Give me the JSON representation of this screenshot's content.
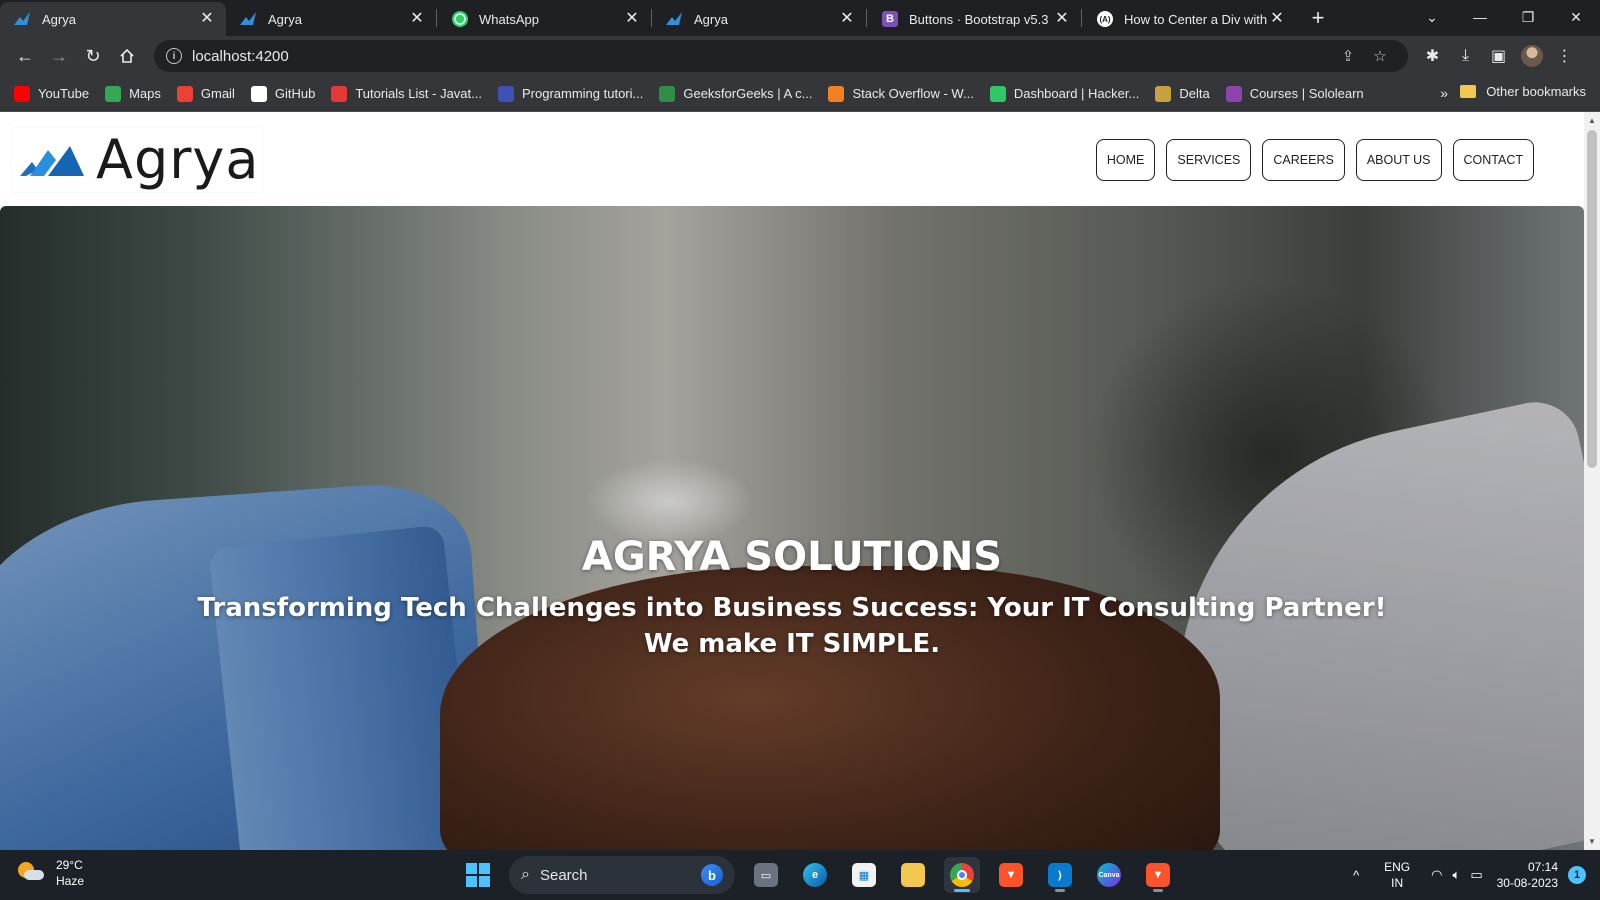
{
  "browser": {
    "tabs": [
      {
        "label": "Agrya",
        "icon": "agrya-favicon",
        "active": true
      },
      {
        "label": "Agrya",
        "icon": "agrya-favicon",
        "active": false
      },
      {
        "label": "WhatsApp",
        "icon": "whatsapp-favicon",
        "active": false
      },
      {
        "label": "Agrya",
        "icon": "agrya-favicon",
        "active": false
      },
      {
        "label": "Buttons · Bootstrap v5.3",
        "icon": "bootstrap-favicon",
        "active": false
      },
      {
        "label": "How to Center a Div with C",
        "icon": "css-favicon",
        "active": false
      }
    ],
    "address": "localhost:4200",
    "bookmarks": [
      {
        "label": "YouTube",
        "icon": "youtube-icon",
        "color": "#ff0000"
      },
      {
        "label": "Maps",
        "icon": "maps-icon",
        "color": "#34a853"
      },
      {
        "label": "Gmail",
        "icon": "gmail-icon",
        "color": "#ea4335"
      },
      {
        "label": "GitHub",
        "icon": "github-icon",
        "color": "#ffffff"
      },
      {
        "label": "Tutorials List - Javat...",
        "icon": "javatpoint-icon",
        "color": "#e53935"
      },
      {
        "label": "Programming tutori...",
        "icon": "programiz-icon",
        "color": "#3f51b5"
      },
      {
        "label": "GeeksforGeeks | A c...",
        "icon": "gfg-icon",
        "color": "#2f8d46"
      },
      {
        "label": "Stack Overflow - W...",
        "icon": "stackoverflow-icon",
        "color": "#f48024"
      },
      {
        "label": "Dashboard | Hacker...",
        "icon": "hackerrank-icon",
        "color": "#2ec866"
      },
      {
        "label": "Delta",
        "icon": "delta-icon",
        "color": "#c8a040"
      },
      {
        "label": "Courses | Sololearn",
        "icon": "sololearn-icon",
        "color": "#8e44ad"
      }
    ],
    "more_bookmarks": "»",
    "other_bookmarks": "Other bookmarks"
  },
  "site": {
    "logo_text": "Agrya",
    "nav": [
      "HOME",
      "SERVICES",
      "CAREERS",
      "ABOUT US",
      "CONTACT"
    ],
    "hero": {
      "title": "AGRYA SOLUTIONS",
      "subtitle_line1": "Transforming Tech Challenges into Business Success: Your IT Consulting Partner!",
      "subtitle_line2": "We make IT SIMPLE."
    }
  },
  "taskbar": {
    "weather_temp": "29°C",
    "weather_desc": "Haze",
    "search_placeholder": "Search",
    "lang_line1": "ENG",
    "lang_line2": "IN",
    "time": "07:14",
    "date": "30-08-2023",
    "notification_count": "1"
  }
}
